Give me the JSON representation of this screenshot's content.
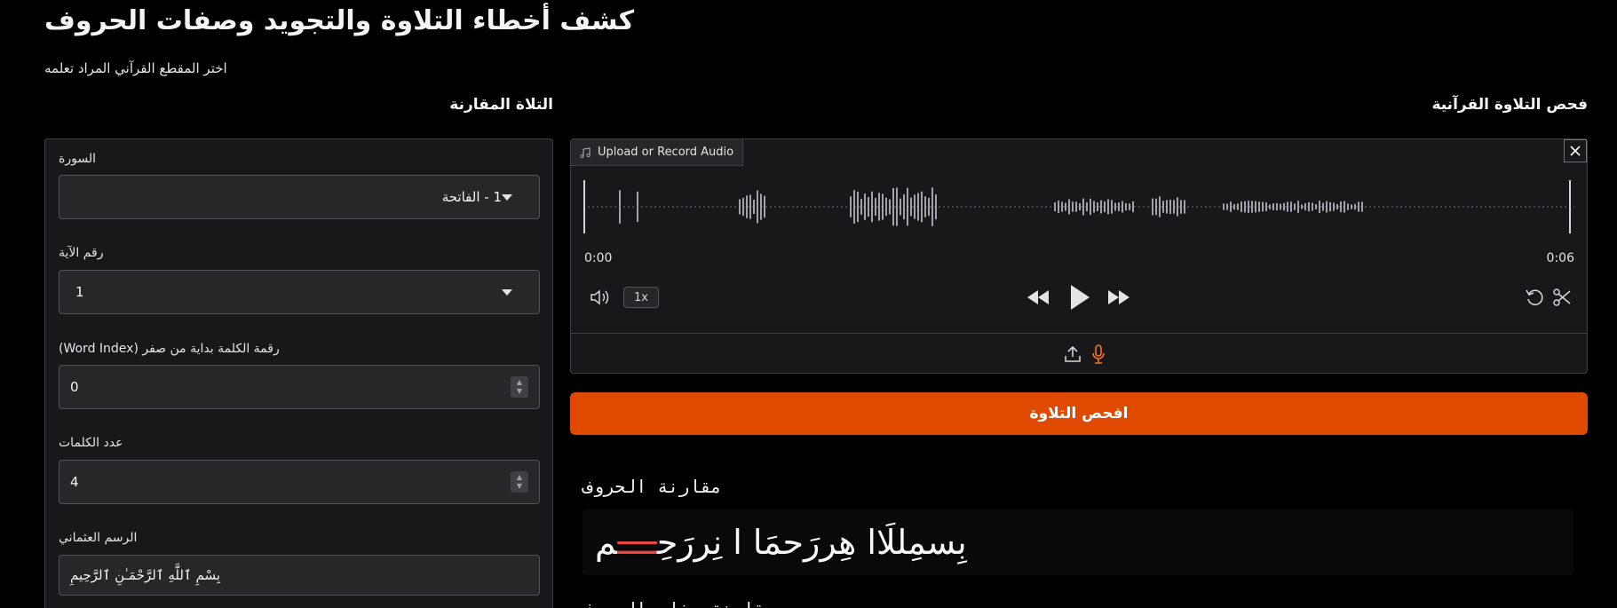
{
  "app": {
    "title": "كشف أخطاء التلاوة والتجويد وصفات الحروف",
    "subtitle": "اختر المقطع القرآني المراد تعلمه"
  },
  "left": {
    "section_title": "التلاة المقارنة",
    "surah": {
      "label": "السورة",
      "value": "1 - الفاتحة"
    },
    "aya": {
      "label": "رقم الآية",
      "value": "1"
    },
    "word_index": {
      "label": "رقمة الكلمة بداية من صفر (Word Index)",
      "value": "0"
    },
    "word_count": {
      "label": "عدد الكلمات",
      "value": "4"
    },
    "uthmani": {
      "label": "الرسم العثماني",
      "value": "بِسْمِ ٱللَّهِ ٱلرَّحْمَـٰنِ ٱلرَّحِيمِ"
    }
  },
  "right": {
    "section_title": "فحص التلاوة القرآنية",
    "audio": {
      "tab_label": "Upload or Record Audio",
      "time_start": "0:00",
      "time_end": "0:06",
      "speed": "1x",
      "accent_color": "#f97316"
    },
    "check_button": "افحص التلاوة",
    "compare_title": "مقارنة الحروف",
    "compare_text_ok": "بِسمِللَاا هِررَحمَا ا نِررَحِ",
    "compare_text_err": "ــــ",
    "compare_text_tail": "م",
    "next_title": "مقارنة صفات الحروف"
  },
  "colors": {
    "primary_button": "#e04a00",
    "panel_bg": "#18181b",
    "error": "#ef4444"
  }
}
